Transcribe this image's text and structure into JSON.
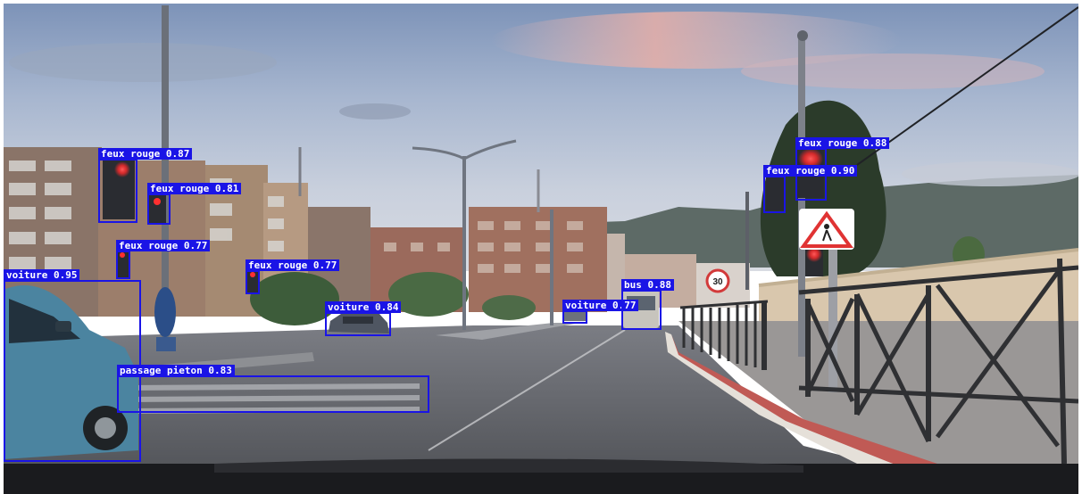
{
  "detections": [
    {
      "name": "det-feux-rouge-1",
      "text": "feux rouge 0.87"
    },
    {
      "name": "det-feux-rouge-2",
      "text": "feux rouge 0.81"
    },
    {
      "name": "det-feux-rouge-3",
      "text": "feux rouge 0.77"
    },
    {
      "name": "det-feux-rouge-4",
      "text": "feux rouge 0.77"
    },
    {
      "name": "det-voiture-1",
      "text": "voiture 0.95"
    },
    {
      "name": "det-voiture-2",
      "text": "voiture 0.84"
    },
    {
      "name": "det-voiture-3",
      "text": "voiture 0.77"
    },
    {
      "name": "det-bus",
      "text": "bus 0.88"
    },
    {
      "name": "det-passage-pieton",
      "text": "passage pieton 0.83"
    },
    {
      "name": "det-feux-rouge-5",
      "text": "feux rouge 0.88"
    },
    {
      "name": "det-feux-rouge-6",
      "text": "feux rouge 0.90"
    }
  ],
  "sign": {
    "speed_limit": "30"
  },
  "colors": {
    "box": "#1a14e6",
    "label_text": "#ffffff",
    "signal_red": "#ff2a2a"
  }
}
